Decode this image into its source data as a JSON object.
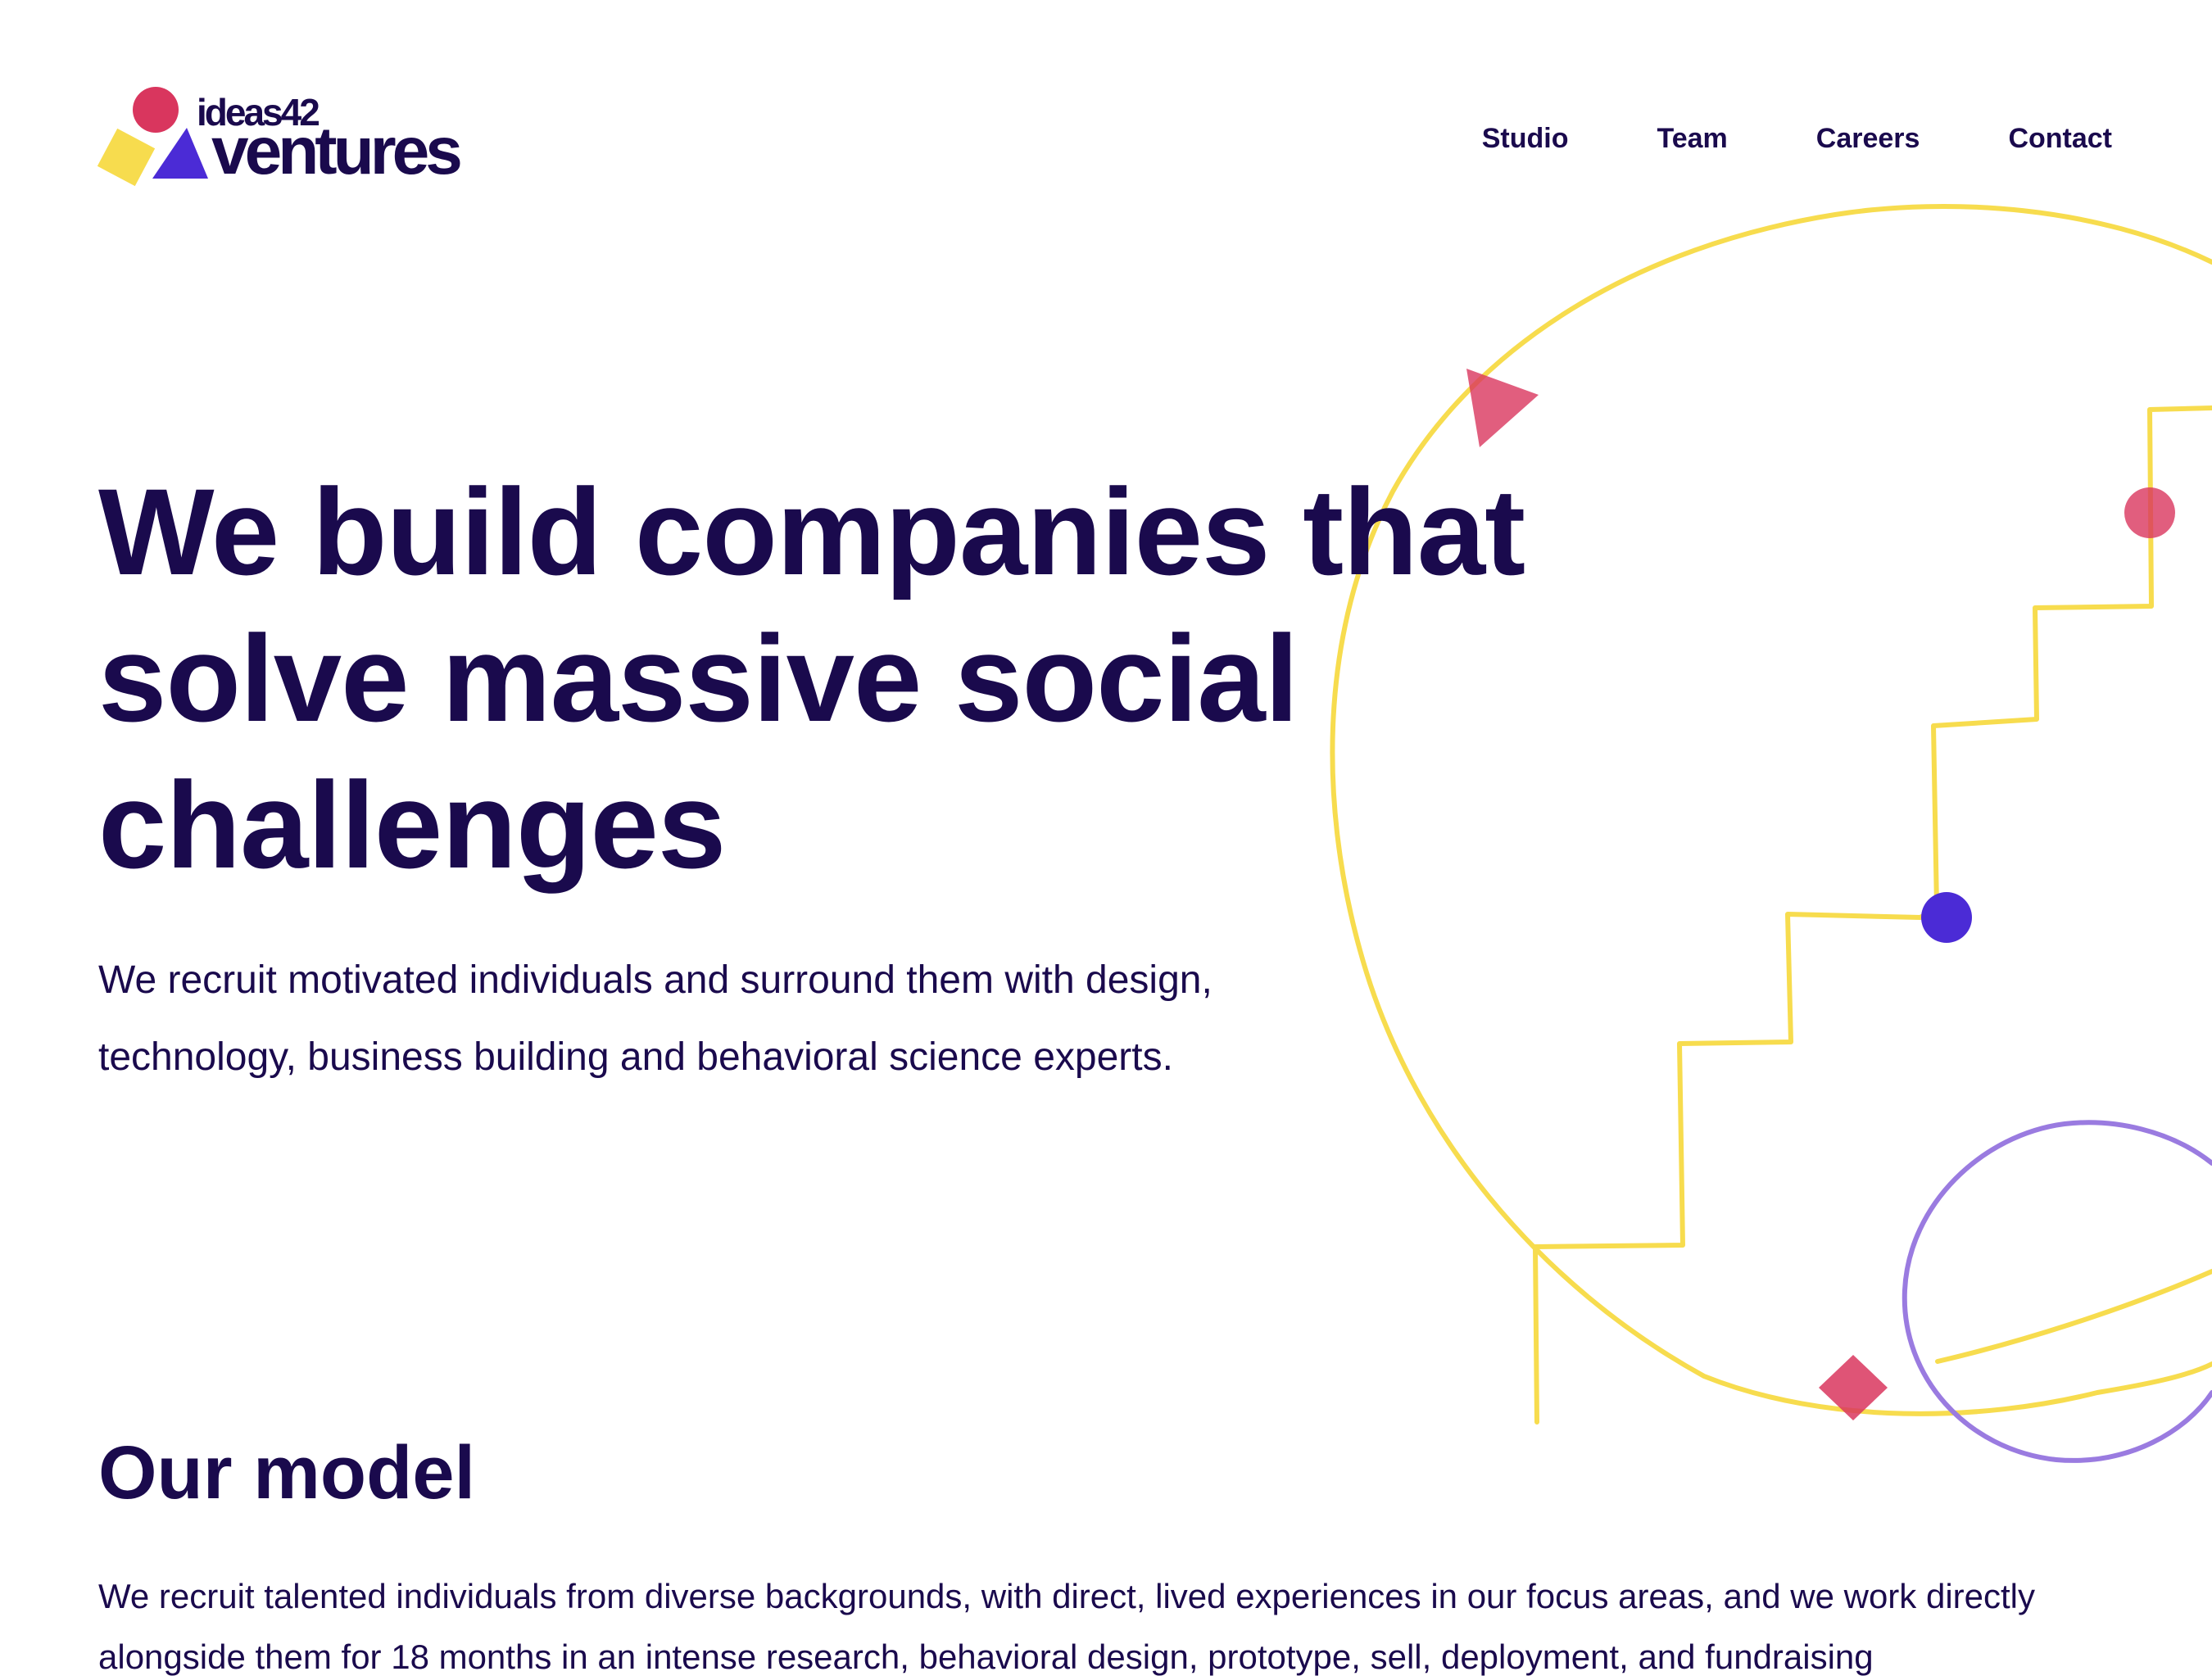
{
  "brand": {
    "logo_small": "ideas42",
    "logo_big": "ventures",
    "colors": {
      "navy": "#1a0a4d",
      "red": "#d9365e",
      "yellow": "#f7dc4e",
      "purple": "#4b2bd6",
      "lavender": "#9a7be0"
    }
  },
  "nav": {
    "items": [
      {
        "label": "Studio"
      },
      {
        "label": "Team"
      },
      {
        "label": "Careers"
      },
      {
        "label": "Contact"
      }
    ]
  },
  "hero": {
    "title": "We build companies that solve massive social challenges",
    "subtitle": "We recruit motivated individuals and surround them with design, technology, business building and behavioral science experts."
  },
  "model": {
    "title": "Our model",
    "body": "We recruit talented individuals from diverse backgrounds, with direct, lived experiences in our focus areas, and we work directly alongside them for 18 months in an intense research, behavioral design, prototype, sell, deployment, and fundraising"
  },
  "decorations": {
    "icons": [
      "large-yellow-circle-outline",
      "red-triangle",
      "red-dot",
      "staircase-line",
      "blue-dot",
      "red-diamond",
      "lavender-circle-outline"
    ]
  }
}
